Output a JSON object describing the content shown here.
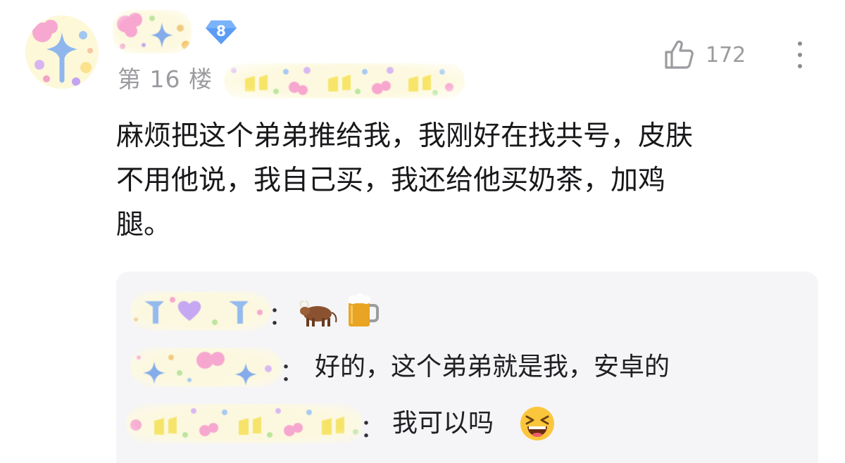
{
  "post": {
    "floor": "第 16 楼",
    "level": "8",
    "likes": "172",
    "icons": {
      "avatar": "avatar-image",
      "level": "level-diamond-icon",
      "like": "thumbs-up-icon",
      "more": "more-vertical-icon"
    },
    "body_lines": [
      "麻烦把这个弟弟推给我，我刚好在找共号，皮肤",
      "不用他说，我自己买，我还给他买奶茶，加鸡",
      "腿。"
    ]
  },
  "replies": [
    {
      "separator": "：",
      "content": "",
      "emojis": [
        "ox-emoji",
        "beer-mug-emoji"
      ]
    },
    {
      "separator": "：",
      "content": "好的，这个弟弟就是我，安卓的",
      "emojis": []
    },
    {
      "separator": "：",
      "content": "我可以吗",
      "emojis": [
        "grinning-squinting-face-emoji"
      ]
    }
  ],
  "colors": {
    "text": "#18181b",
    "muted": "#9b9ba0",
    "reply_bg": "#f5f5f7",
    "badge_blue": "#5b9df5"
  }
}
